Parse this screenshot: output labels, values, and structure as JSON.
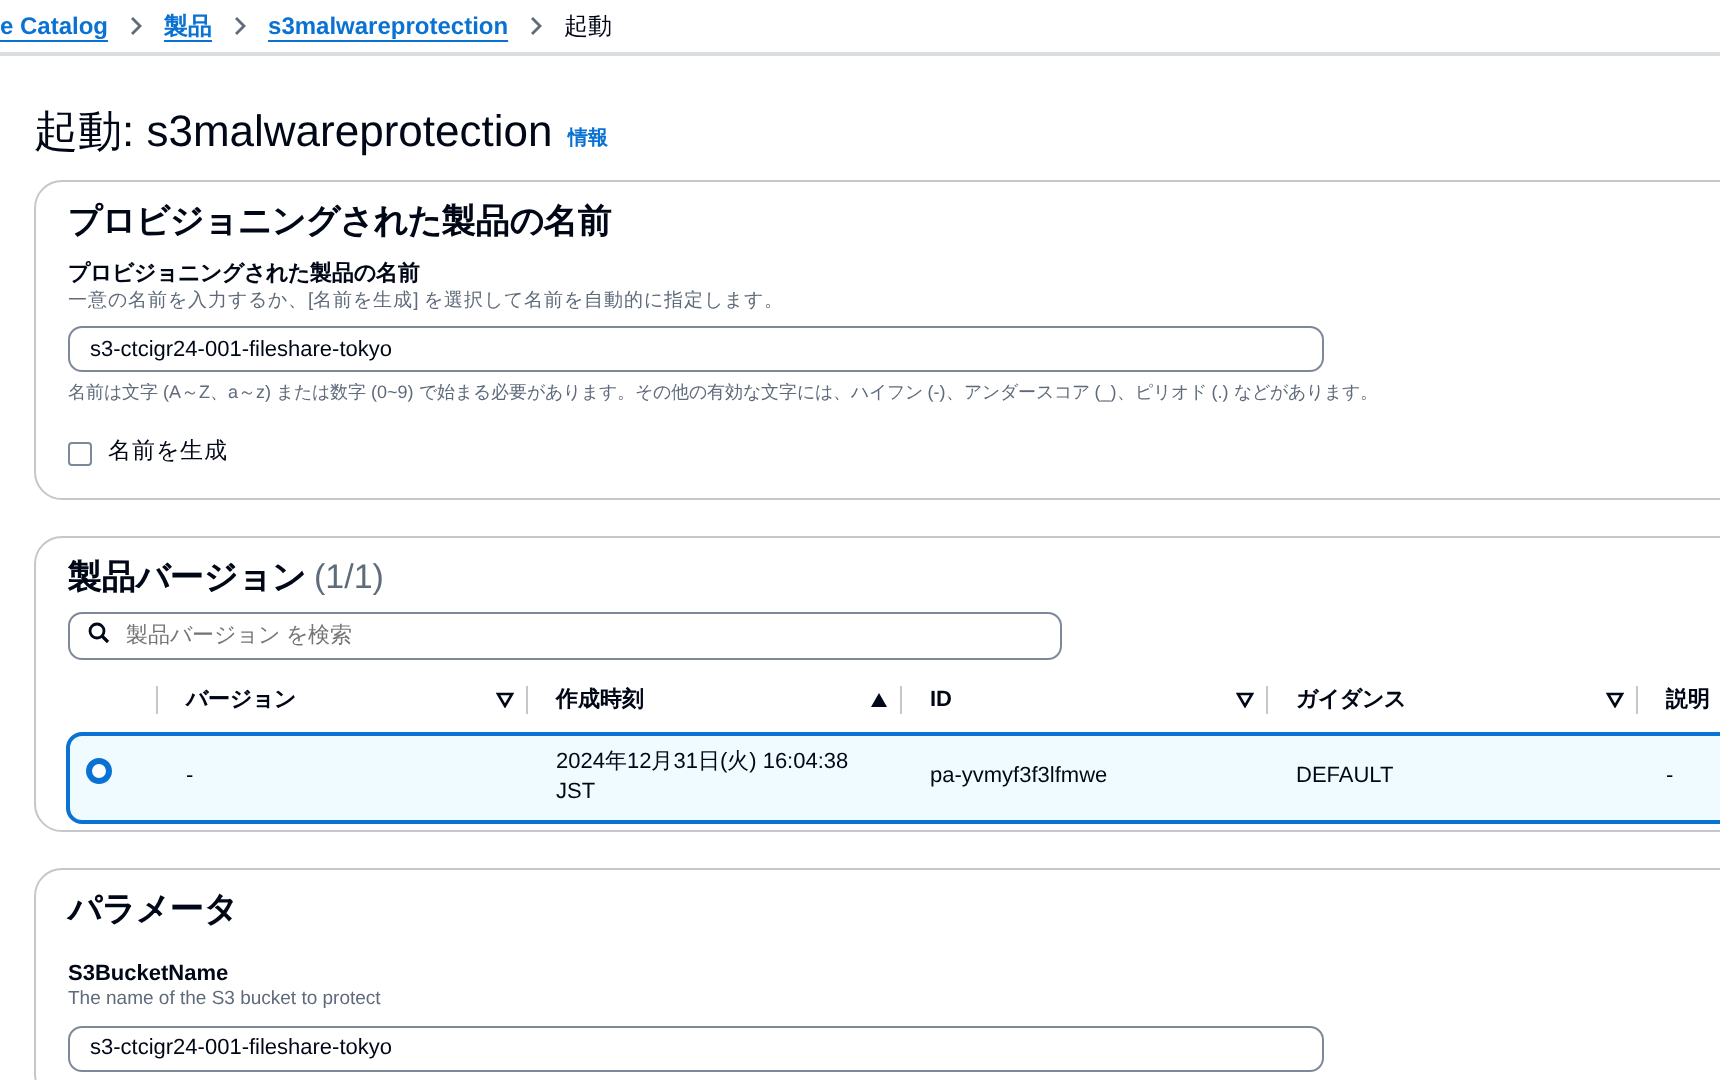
{
  "breadcrumb": [
    {
      "label": "e Catalog",
      "link": true
    },
    {
      "label": "製品",
      "link": true
    },
    {
      "label": "s3malwareprotection",
      "link": true
    },
    {
      "label": "起動",
      "link": false
    }
  ],
  "page_title": "起動: s3malwareprotection",
  "info_link": "情報",
  "name_section": {
    "heading": "プロビジョニングされた製品の名前",
    "field_label": "プロビジョニングされた製品の名前",
    "description": "一意の名前を入力するか、[名前を生成] を選択して名前を自動的に指定します。",
    "value": "s3-ctcigr24-001-fileshare-tokyo",
    "constraint": "名前は文字 (A～Z、a～z) または数字 (0~9) で始まる必要があります。その他の有効な文字には、ハイフン (-)、アンダースコア (_)、ピリオド (.) などがあります。",
    "generate_checkbox": {
      "label": "名前を生成",
      "checked": false
    }
  },
  "versions": {
    "heading": "製品バージョン",
    "count": "(1/1)",
    "search": {
      "placeholder": "製品バージョン を検索"
    },
    "columns": [
      {
        "label": "バージョン",
        "sorted": false
      },
      {
        "label": "作成時刻",
        "sorted": true
      },
      {
        "label": "ID",
        "sorted": false
      },
      {
        "label": "ガイダンス",
        "sorted": false
      },
      {
        "label": "説明"
      }
    ],
    "rows": [
      {
        "selected": true,
        "cells": [
          "-",
          "2024年12月31日(火) 16:04:38 JST",
          "pa-yvmyf3f3lfmwe",
          "DEFAULT",
          "-"
        ]
      }
    ]
  },
  "parameters": {
    "heading": "パラメータ",
    "fields": [
      {
        "label": "S3BucketName",
        "description": "The name of the S3 bucket to protect",
        "value": "s3-ctcigr24-001-fileshare-tokyo"
      }
    ]
  }
}
